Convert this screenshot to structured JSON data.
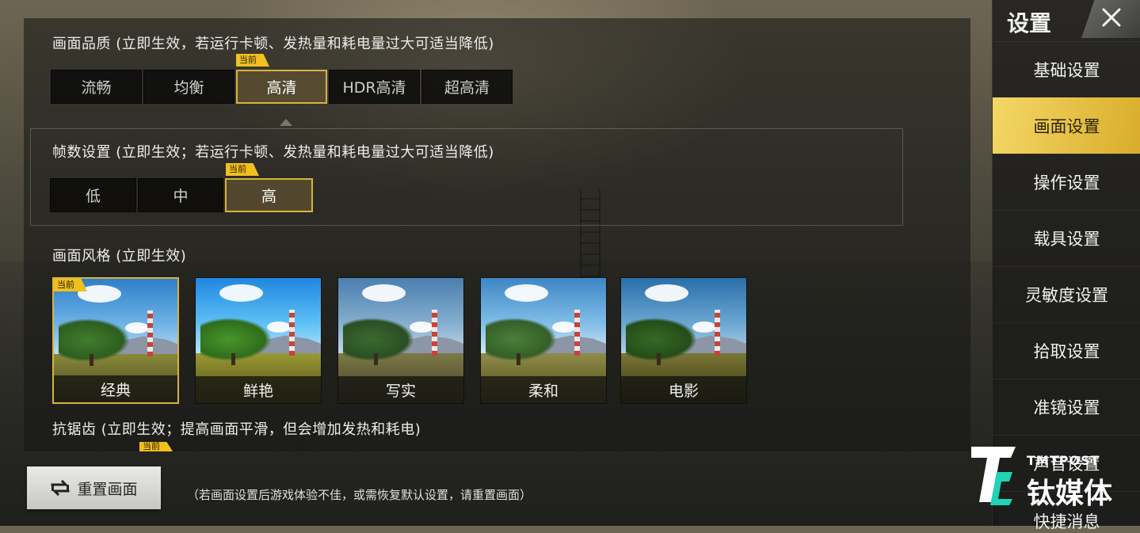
{
  "quality": {
    "title": "画面品质 (立即生效，若运行卡顿、发热量和耗电量过大可适当降低)",
    "current_tag": "当前",
    "options": [
      "流畅",
      "均衡",
      "高清",
      "HDR高清",
      "超高清"
    ],
    "selected": "高清"
  },
  "fps": {
    "title": "帧数设置 (立即生效；若运行卡顿、发热量和耗电量过大可适当降低)",
    "current_tag": "当前",
    "options": [
      "低",
      "中",
      "高"
    ],
    "selected": "高"
  },
  "style": {
    "title": "画面风格 (立即生效)",
    "current_tag": "当前",
    "options": [
      "经典",
      "鲜艳",
      "写实",
      "柔和",
      "电影"
    ],
    "selected": "经典"
  },
  "antialias": {
    "title": "抗锯齿 (立即生效；提高画面平滑，但会增加发热和耗电)",
    "current_tag": "当前"
  },
  "reset": {
    "label": "重置画面",
    "note": "（若画面设置后游戏体验不佳，或需恢复默认设置，请重置画面）"
  },
  "sidebar": {
    "title": "设置",
    "items": [
      "基础设置",
      "画面设置",
      "操作设置",
      "载具设置",
      "灵敏度设置",
      "拾取设置",
      "准镜设置",
      "声音设置",
      "快捷消息"
    ],
    "active": "画面设置"
  },
  "watermark": {
    "small": "TMTPOST",
    "big": "钛媒体"
  },
  "colors": {
    "accent": "#f2c01e",
    "selected_border": "#d9b23b",
    "active_sidebar": "#e8c24a"
  }
}
